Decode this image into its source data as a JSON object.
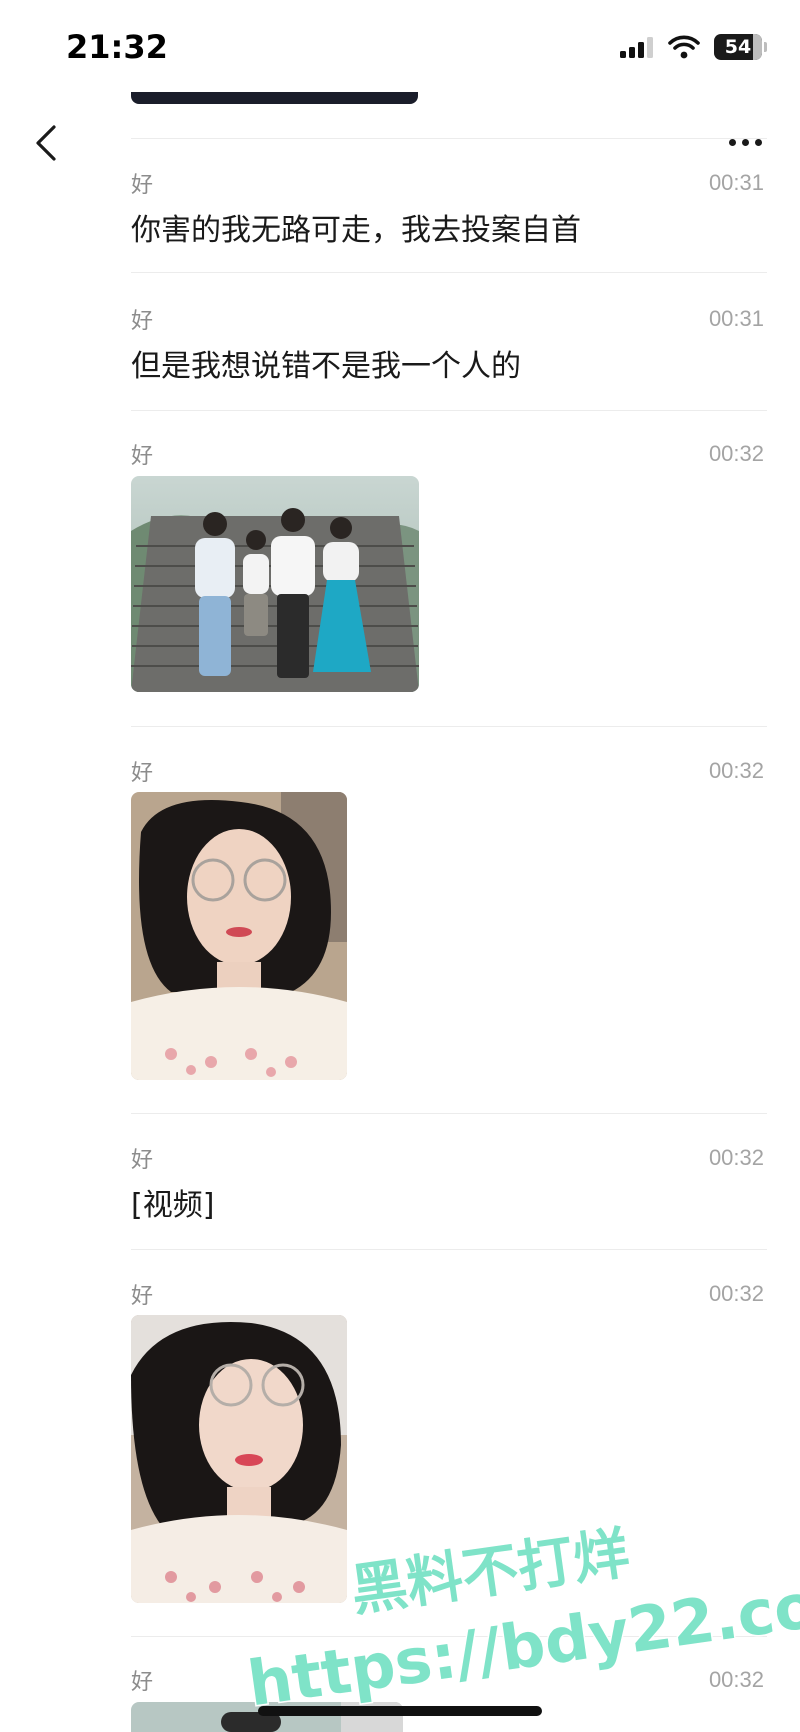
{
  "status_bar": {
    "time": "21:32",
    "battery": "54"
  },
  "messages": [
    {
      "sender": "好",
      "time": "00:31",
      "text": "你害的我无路可走，我去投案自首"
    },
    {
      "sender": "好",
      "time": "00:31",
      "text": "但是我想说错不是我一个人的"
    },
    {
      "sender": "好",
      "time": "00:32",
      "type": "image",
      "image_icon": "family-photo-icon"
    },
    {
      "sender": "好",
      "time": "00:32",
      "type": "image",
      "image_icon": "portrait-photo-icon"
    },
    {
      "sender": "好",
      "time": "00:32",
      "text": "[视频]"
    },
    {
      "sender": "好",
      "time": "00:32",
      "type": "image",
      "image_icon": "portrait-photo-icon"
    },
    {
      "sender": "好",
      "time": "00:32",
      "type": "image",
      "image_icon": "photo-icon"
    }
  ],
  "watermark": {
    "line1": "黑料不打烊",
    "line2": "https://bdy22.co",
    "color": "#7fe3c8"
  },
  "icons": {
    "back": "chevron-left-icon",
    "more": "more-horizontal-icon"
  }
}
